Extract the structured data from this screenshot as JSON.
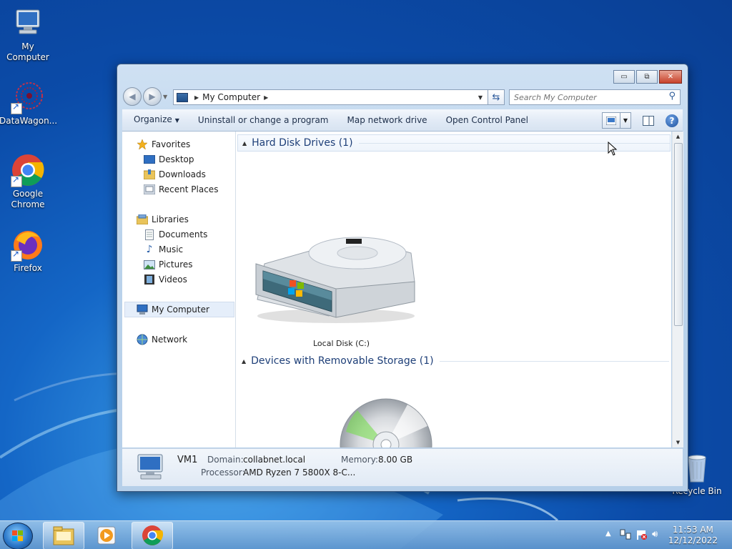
{
  "desktop": {
    "icons": [
      {
        "label": "My Computer"
      },
      {
        "label": "DataWagon..."
      },
      {
        "label": "Google Chrome"
      },
      {
        "label": "Firefox"
      },
      {
        "label": "Recycle Bin"
      }
    ]
  },
  "window": {
    "caption": {
      "minimize": "▭",
      "maximize": "⧉",
      "close": "✕"
    },
    "address": {
      "path": "My Computer"
    },
    "search": {
      "placeholder": "Search My Computer"
    },
    "commands": {
      "organize": "Organize",
      "uninstall": "Uninstall or change a program",
      "map_drive": "Map network drive",
      "control_panel": "Open Control Panel"
    },
    "nav": {
      "favorites": "Favorites",
      "desktop": "Desktop",
      "downloads": "Downloads",
      "recent": "Recent Places",
      "libraries": "Libraries",
      "documents": "Documents",
      "music": "Music",
      "pictures": "Pictures",
      "videos": "Videos",
      "my_computer": "My Computer",
      "network": "Network"
    },
    "groups": {
      "hdd": "Hard Disk Drives (1)",
      "removable": "Devices with Removable Storage (1)"
    },
    "drives": {
      "local_disk": "Local Disk (C:)"
    },
    "details": {
      "name": "VM1",
      "domain_label": "Domain:",
      "domain": "collabnet.local",
      "memory_label": "Memory:",
      "memory": "8.00 GB",
      "processor_label": "Processor:",
      "processor": "AMD Ryzen 7 5800X 8-C..."
    }
  },
  "taskbar": {
    "time": "11:53 AM",
    "date": "12/12/2022"
  }
}
